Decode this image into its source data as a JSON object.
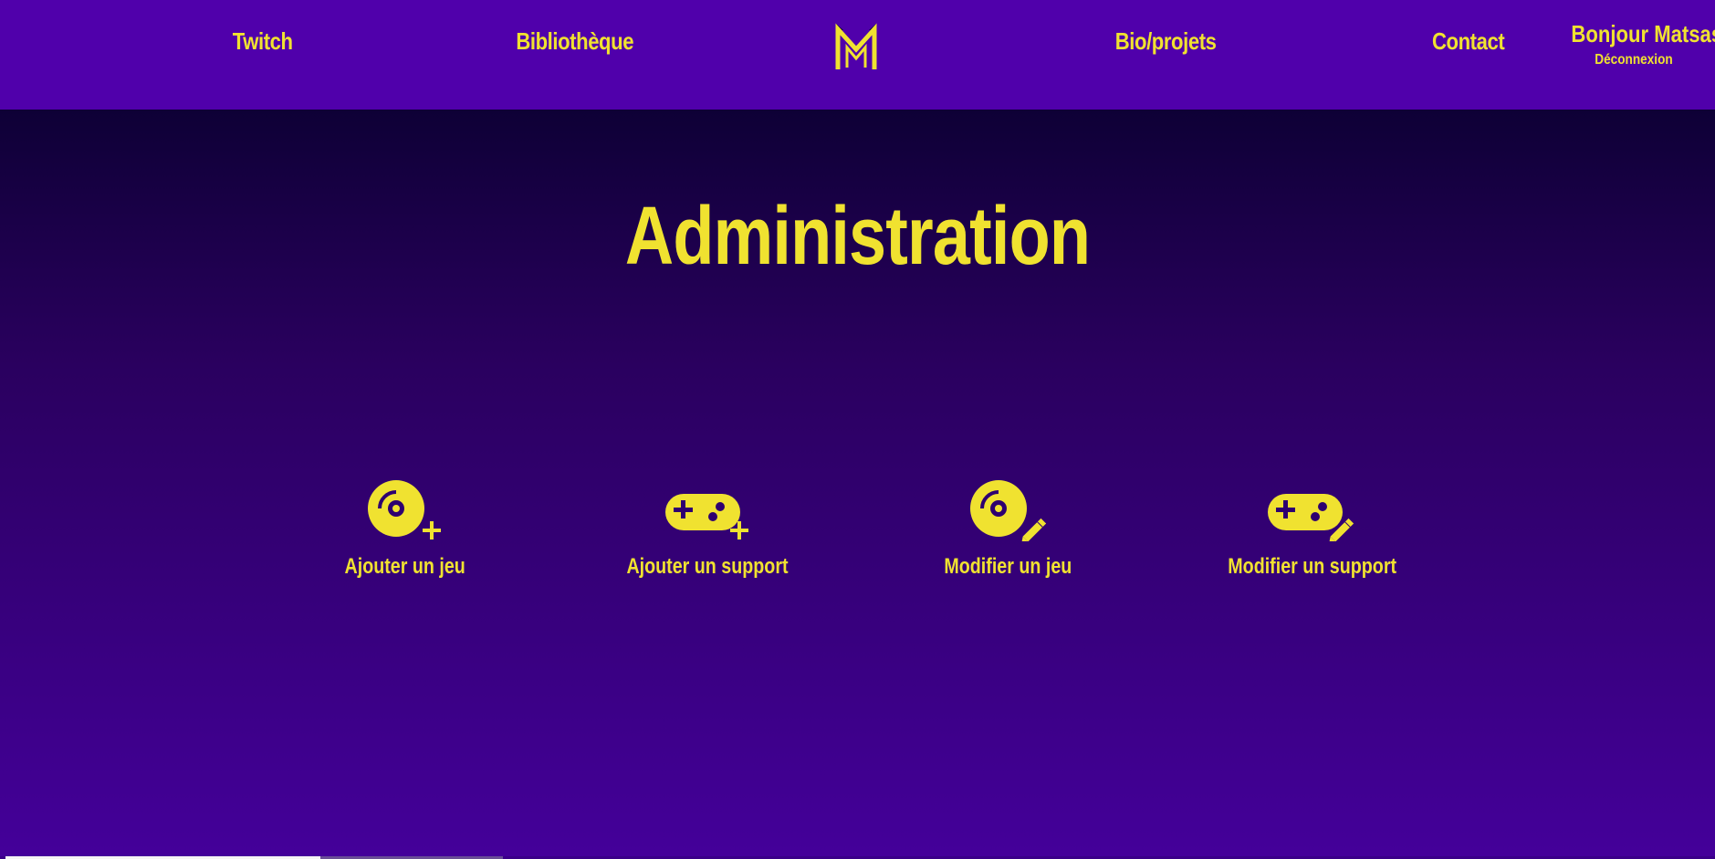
{
  "nav": {
    "items": [
      {
        "label": "Twitch"
      },
      {
        "label": "Bibliothèque"
      },
      {
        "label": "Bio/projets"
      },
      {
        "label": "Contact"
      }
    ],
    "user_greeting": "Bonjour Matsashi",
    "logout_label": "Déconnexion",
    "logo_icon": "m-crown-logo-icon"
  },
  "main": {
    "title": "Administration",
    "actions": [
      {
        "label": "Ajouter un jeu",
        "icon": "disc-plus-icon"
      },
      {
        "label": "Ajouter un support",
        "icon": "gamepad-plus-icon"
      },
      {
        "label": "Modifier un jeu",
        "icon": "disc-edit-icon"
      },
      {
        "label": "Modifier un support",
        "icon": "gamepad-edit-icon"
      }
    ]
  },
  "colors": {
    "accent": "#f0e230",
    "header_bg": "#5000ab",
    "bg_top": "#0e0036",
    "bg_bottom": "#44009a"
  }
}
